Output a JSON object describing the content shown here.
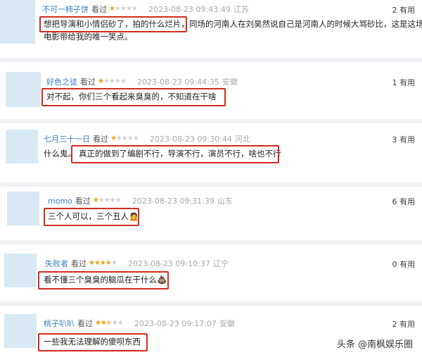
{
  "comments": [
    {
      "user": "不可一柿子饼",
      "seen": "看过",
      "rating": 1,
      "time": "2023-08-23 09:43:49",
      "location": "江苏",
      "useful": "2 有用",
      "text_highlight": "想把导演和小情侣砂了，拍的什么烂片，",
      "text_rest": "同场的河南人在刘昊然说自己是河南人的时候大骂砂比，这是这场",
      "text_line2": "电影带给我的唯一笑点。"
    },
    {
      "user": "好色之徒",
      "seen": "看过",
      "rating": 1,
      "time": "2023-08-23 09:44:35",
      "location": "安徽",
      "useful": "1 有用",
      "text_highlight": "对不起，你们三个看起来臭臭的，不知道在干啥"
    },
    {
      "user": "七月三十一日",
      "seen": "看过",
      "rating": 1,
      "time": "2023-08-23 09:30:44",
      "location": "河北",
      "useful": "3 有用",
      "text_prefix": "什么鬼。",
      "text_highlight": "真正的做到了编剧不行，导演不行，演员不行，啥也不行"
    },
    {
      "user": "momo",
      "seen": "看过",
      "rating": 1,
      "time": "2023-08-23 09:31:39",
      "location": "山东",
      "useful": "6 有用",
      "text_highlight": "三个人可以，三个丑人🙍"
    },
    {
      "user": "失败者",
      "seen": "看过",
      "rating": 3,
      "time": "2023-08-23 09:10:37",
      "location": "辽宁",
      "useful": "0 有用",
      "text_highlight": "看不懂三个臭臭的脑瓜在干什么💩"
    },
    {
      "user": "桃子叭叭",
      "seen": "看过",
      "rating": 2,
      "time": "2023-08-23 09:17:07",
      "location": "安徽",
      "useful": "2 有用",
      "text_highlight": "一些我无法理解的傻呗东西"
    }
  ],
  "watermark": "头条 @南枫娱乐圈",
  "colors": {
    "highlight_box": "#d32b23",
    "username": "#3a7fc3",
    "star": "#f0a515",
    "avatar": "#d8e9f3"
  }
}
